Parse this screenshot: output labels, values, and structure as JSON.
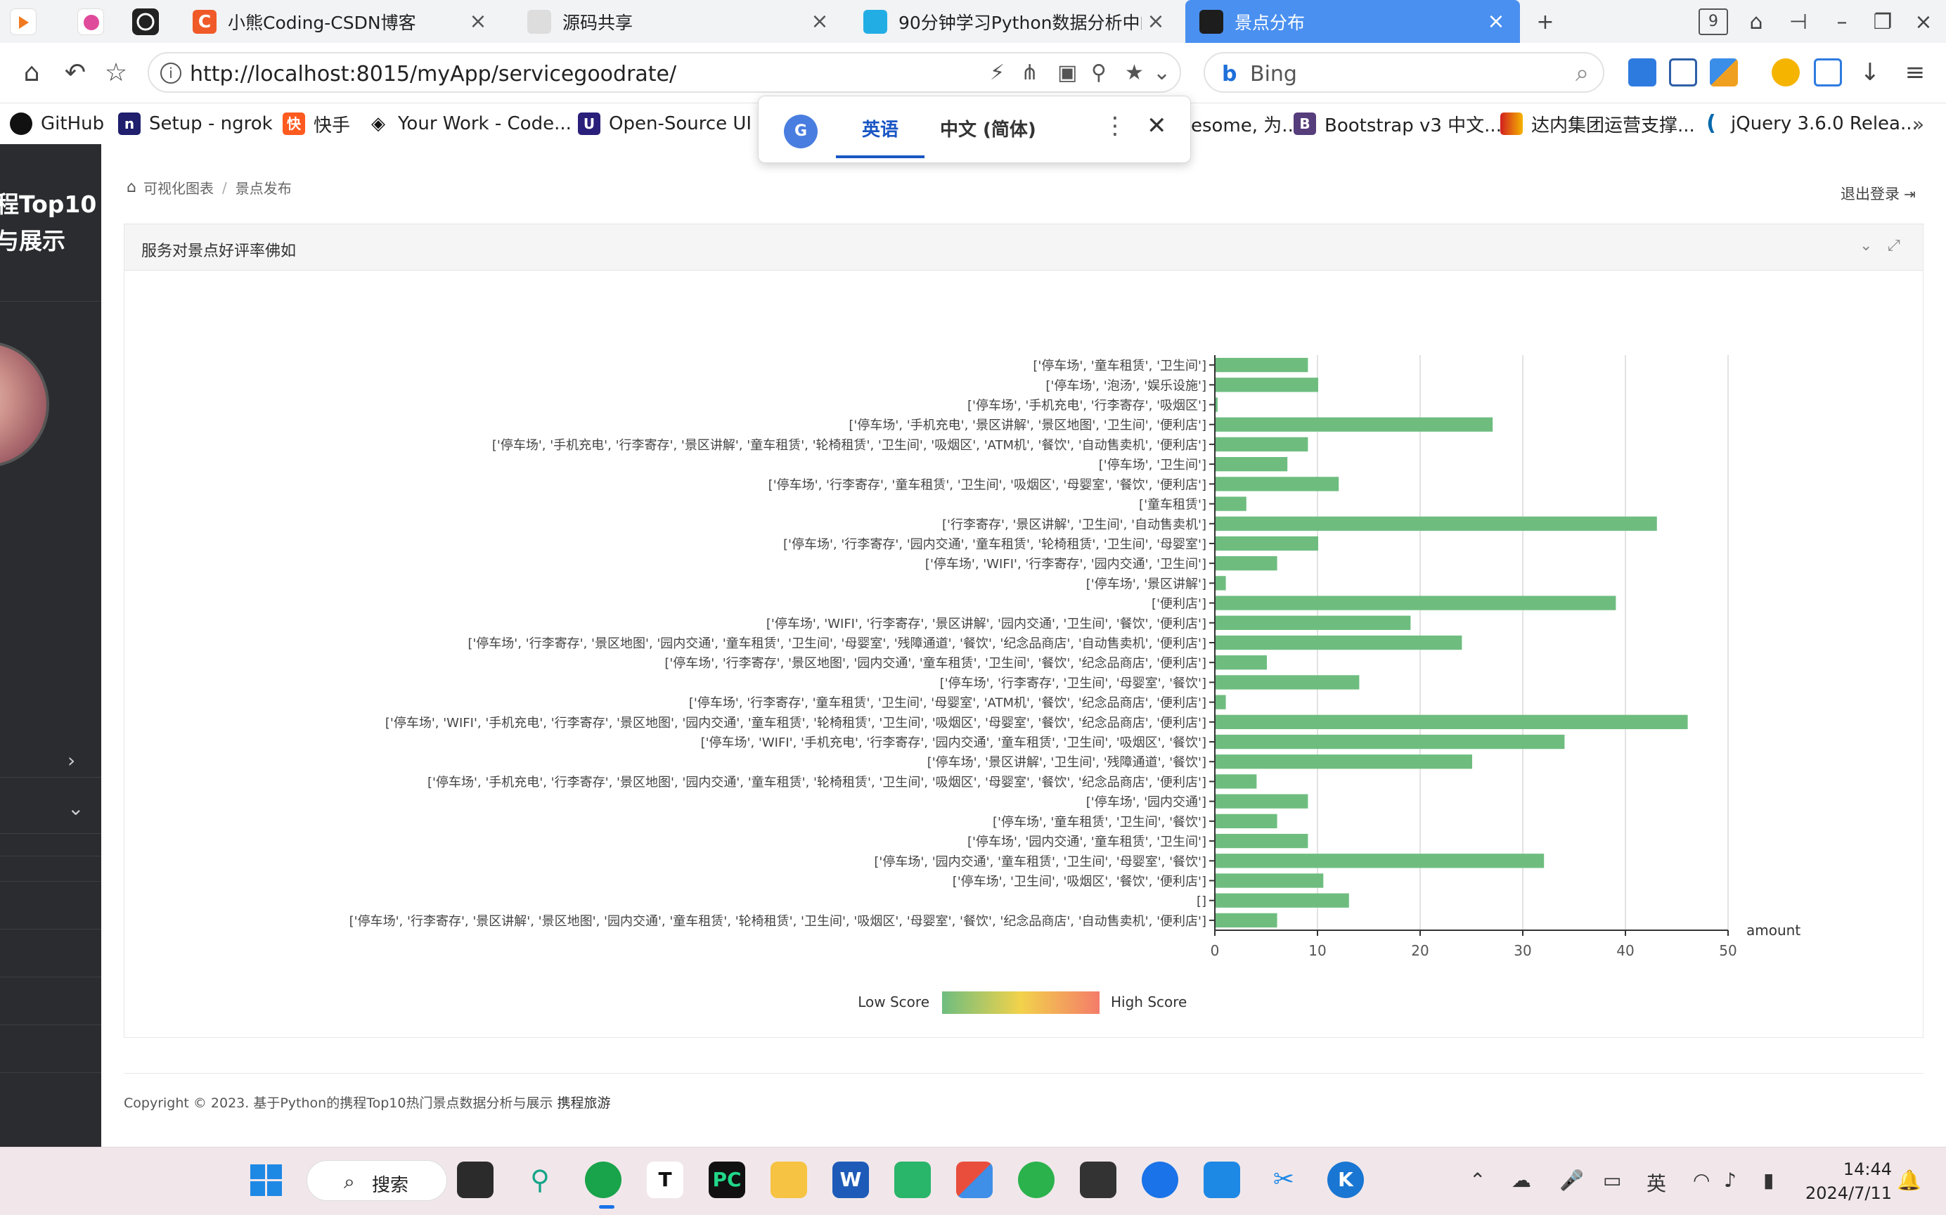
{
  "browser": {
    "tabs": [
      {
        "title": "",
        "icon": "pin-icon",
        "color": "#ffffff"
      },
      {
        "title": "",
        "icon": "pin-icon",
        "color": "#ffffff"
      },
      {
        "title": "",
        "icon": "pin-icon",
        "color": "#222222"
      },
      {
        "title": "小熊Coding-CSDN博客",
        "icon": "csdn-icon",
        "color": "#f05a28"
      },
      {
        "title": "源码共享",
        "icon": "source-icon",
        "color": "#9a9a9a"
      },
      {
        "title": "90分钟学习Python数据分析中的",
        "icon": "bilibili-icon",
        "color": "#23ade5"
      },
      {
        "title": "景点分布",
        "icon": "page-icon",
        "color": "#1d1d1d"
      }
    ],
    "tab_count": "9",
    "url": "http://localhost:8015/myApp/servicegoodrate/",
    "search_engine": "Bing",
    "bookmarks": [
      {
        "label": "GitHub",
        "icon": "github-icon",
        "color": "#111111",
        "glyph": "●"
      },
      {
        "label": "Setup - ngrok",
        "icon": "ngrok-icon",
        "color": "#1f1f6e",
        "glyph": "n"
      },
      {
        "label": "快手",
        "icon": "kuaishou-icon",
        "color": "#ff5a1f",
        "glyph": "快"
      },
      {
        "label": "Your Work - Code...",
        "icon": "codepen-icon",
        "color": "#111111",
        "glyph": "◆"
      },
      {
        "label": "Open-Source UI e...",
        "icon": "ui-icon",
        "color": "#2a1f7a",
        "glyph": "U"
      },
      {
        "label": "esome, 为...",
        "icon": "awesome-icon",
        "color": "#ffffff",
        "glyph": ""
      },
      {
        "label": "Bootstrap v3 中文...",
        "icon": "bootstrap-icon",
        "color": "#563d7c",
        "glyph": "B"
      },
      {
        "label": "达内集团运营支撑...",
        "icon": "tarena-icon",
        "color": "#d11f1f",
        "glyph": "▦"
      },
      {
        "label": "jQuery 3.6.0 Relea...",
        "icon": "jquery-icon",
        "color": "#0769ad",
        "glyph": "("
      }
    ]
  },
  "translate_popup": {
    "tab_active": "英语",
    "tab_other": "中文 (简体)"
  },
  "sidebar": {
    "brand_line1": "程Top10",
    "brand_line2": "与展示"
  },
  "breadcrumb": {
    "home": "可视化图表",
    "current": "景点发布"
  },
  "header": {
    "logout": "退出登录"
  },
  "panel": {
    "title": "服务对景点好评率佛如"
  },
  "chart_data": {
    "type": "bar",
    "orientation": "horizontal",
    "title": "",
    "xlabel": "amount",
    "xlim": [
      0,
      50
    ],
    "x_ticks": [
      0,
      10,
      20,
      30,
      40,
      50
    ],
    "bar_color": "#6ebd7f",
    "grid": true,
    "visual_map": {
      "low_label": "Low Score",
      "high_label": "High Score",
      "colors": [
        "#6ebd7f",
        "#f2d24b",
        "#f47c6a"
      ]
    },
    "categories": [
      "['停车场', '童车租赁', '卫生间']",
      "['停车场', '泡汤', '娱乐设施']",
      "['停车场', '手机充电', '行李寄存', '吸烟区']",
      "['停车场', '手机充电', '景区讲解', '景区地图', '卫生间', '便利店']",
      "['停车场', '手机充电', '行李寄存', '景区讲解', '童车租赁', '轮椅租赁', '卫生间', '吸烟区', 'ATM机', '餐饮', '自动售卖机', '便利店']",
      "['停车场', '卫生间']",
      "['停车场', '行李寄存', '童车租赁', '卫生间', '吸烟区', '母婴室', '餐饮', '便利店']",
      "['童车租赁']",
      "['行李寄存', '景区讲解', '卫生间', '自动售卖机']",
      "['停车场', '行李寄存', '园内交通', '童车租赁', '轮椅租赁', '卫生间', '母婴室']",
      "['停车场', 'WIFI', '行李寄存', '园内交通', '卫生间']",
      "['停车场', '景区讲解']",
      "['便利店']",
      "['停车场', 'WIFI', '行李寄存', '景区讲解', '园内交通', '卫生间', '餐饮', '便利店']",
      "['停车场', '行李寄存', '景区地图', '园内交通', '童车租赁', '卫生间', '母婴室', '残障通道', '餐饮', '纪念品商店', '自动售卖机', '便利店']",
      "['停车场', '行李寄存', '景区地图', '园内交通', '童车租赁', '卫生间', '餐饮', '纪念品商店', '便利店']",
      "['停车场', '行李寄存', '卫生间', '母婴室', '餐饮']",
      "['停车场', '行李寄存', '童车租赁', '卫生间', '母婴室', 'ATM机', '餐饮', '纪念品商店', '便利店']",
      "['停车场', 'WIFI', '手机充电', '行李寄存', '景区地图', '园内交通', '童车租赁', '轮椅租赁', '卫生间', '吸烟区', '母婴室', '餐饮', '纪念品商店', '便利店']",
      "['停车场', 'WIFI', '手机充电', '行李寄存', '园内交通', '童车租赁', '卫生间', '吸烟区', '餐饮']",
      "['停车场', '景区讲解', '卫生间', '残障通道', '餐饮']",
      "['停车场', '手机充电', '行李寄存', '景区地图', '园内交通', '童车租赁', '轮椅租赁', '卫生间', '吸烟区', '母婴室', '餐饮', '纪念品商店', '便利店']",
      "['停车场', '园内交通']",
      "['停车场', '童车租赁', '卫生间', '餐饮']",
      "['停车场', '园内交通', '童车租赁', '卫生间']",
      "['停车场', '园内交通', '童车租赁', '卫生间', '母婴室', '餐饮']",
      "['停车场', '卫生间', '吸烟区', '餐饮', '便利店']",
      "[]",
      "['停车场', '行李寄存', '景区讲解', '景区地图', '园内交通', '童车租赁', '轮椅租赁', '卫生间', '吸烟区', '母婴室', '餐饮', '纪念品商店', '自动售卖机', '便利店']"
    ],
    "values": [
      9,
      10,
      0.2,
      27,
      9,
      7,
      12,
      3,
      43,
      10,
      6,
      1,
      39,
      19,
      24,
      5,
      14,
      1,
      46,
      34,
      25,
      4,
      9,
      6,
      9,
      32,
      10.5,
      13,
      6
    ]
  },
  "footer": {
    "copyright": "Copyright © 2023. 基于Python的携程Top10热门景点数据分析与展示",
    "brand": "携程旅游"
  },
  "taskbar": {
    "search_label": "搜索",
    "ime": "英",
    "time": "14:44",
    "date": "2024/7/11"
  }
}
